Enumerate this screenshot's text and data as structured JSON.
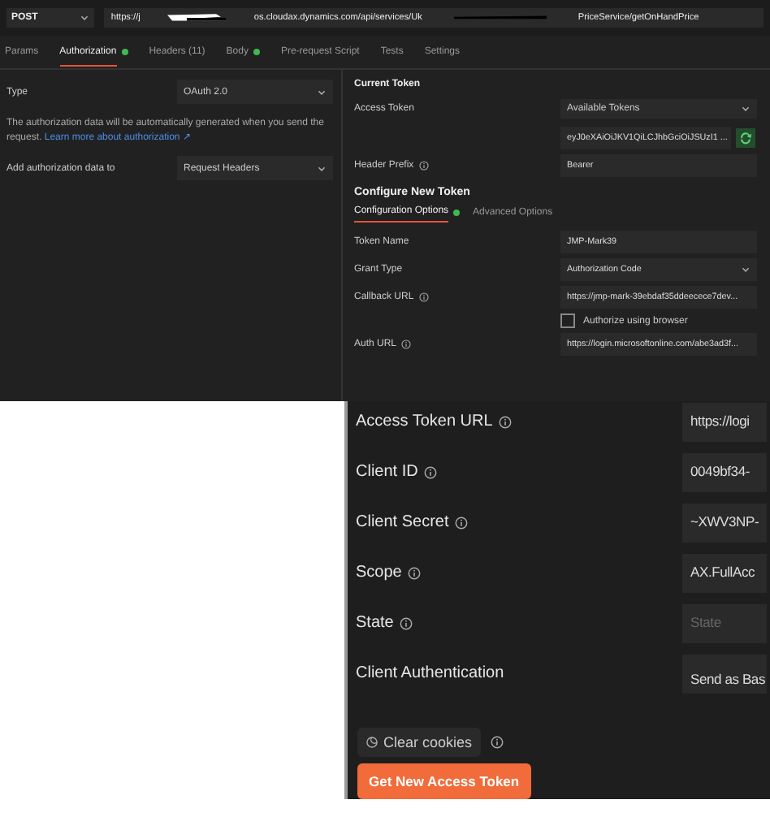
{
  "request": {
    "method": "POST",
    "url_parts": [
      "https://j",
      "os.cloudax.dynamics.com/api/services/Uk",
      "PriceService/getOnHandPrice"
    ]
  },
  "tabs": [
    {
      "label": "Params",
      "selected": false,
      "dot": false
    },
    {
      "label": "Authorization",
      "selected": true,
      "dot": true
    },
    {
      "label": "Headers (11)",
      "selected": false,
      "dot": false
    },
    {
      "label": "Body",
      "selected": false,
      "dot": true
    },
    {
      "label": "Pre-request Script",
      "selected": false,
      "dot": false
    },
    {
      "label": "Tests",
      "selected": false,
      "dot": false
    },
    {
      "label": "Settings",
      "selected": false,
      "dot": false
    }
  ],
  "auth": {
    "type_label": "Type",
    "type_value": "OAuth 2.0",
    "description": "The authorization data will be automatically generated when you send the request.",
    "learn_link": "Learn more about authorization ↗",
    "add_to_label": "Add authorization data to",
    "add_to_value": "Request Headers"
  },
  "current_token": {
    "title": "Current Token",
    "access_token_label": "Access Token",
    "access_token_select": "Available Tokens",
    "token_value": "eyJ0eXAiOiJKV1QiLCJhbGciOiJSUzI1 ...",
    "header_prefix_label": "Header Prefix",
    "header_prefix_value": "Bearer"
  },
  "configure": {
    "title": "Configure New Token",
    "subtabs": [
      {
        "label": "Configuration Options",
        "selected": true,
        "dot": true
      },
      {
        "label": "Advanced Options",
        "selected": false,
        "dot": false
      }
    ],
    "fields": [
      {
        "kind": "text",
        "label": "Token Name",
        "info": false,
        "value": "JMP-Mark39"
      },
      {
        "kind": "select",
        "label": "Grant Type",
        "info": false,
        "value": "Authorization Code"
      },
      {
        "kind": "text",
        "label": "Callback URL",
        "info": true,
        "value": "https://jmp-mark-39ebdaf35ddeecece7dev..."
      },
      {
        "kind": "checkbox",
        "label": "Authorize using browser",
        "checked": false
      },
      {
        "kind": "text",
        "label": "Auth URL",
        "info": true,
        "value": "https://login.microsoftonline.com/abe3ad3f..."
      }
    ]
  },
  "zoomed": {
    "fields": [
      {
        "kind": "text",
        "label": "Access Token URL",
        "info": true,
        "value": "https://logi"
      },
      {
        "kind": "text",
        "label": "Client ID",
        "info": true,
        "value": "0049bf34-"
      },
      {
        "kind": "text",
        "label": "Client Secret",
        "info": true,
        "value": "~XWV3NP-"
      },
      {
        "kind": "text",
        "label": "Scope",
        "info": true,
        "value": "AX.FullAcc"
      },
      {
        "kind": "placeholder",
        "label": "State",
        "info": true,
        "placeholder": "State"
      },
      {
        "kind": "select",
        "label": "Client Authentication",
        "info": false,
        "value": "Send as Bas"
      }
    ],
    "clear_cookies": "Clear cookies",
    "get_token": "Get New Access Token"
  }
}
